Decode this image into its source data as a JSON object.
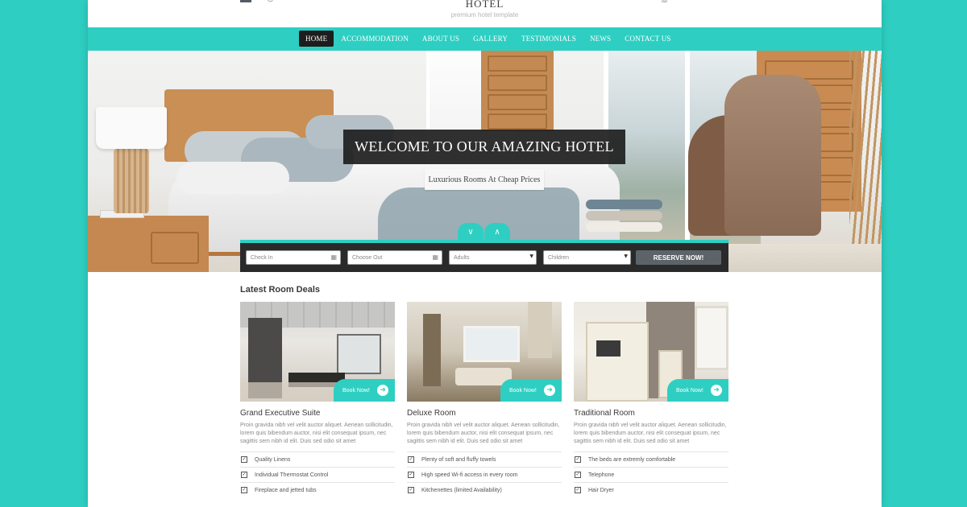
{
  "header": {
    "logo_title": "HOTEL",
    "logo_subtitle": "premium hotel template"
  },
  "nav": {
    "items": [
      "HOME",
      "ACCOMMODATION",
      "ABOUT US",
      "GALLERY",
      "TESTIMONIALS",
      "NEWS",
      "CONTACT US"
    ],
    "active": "HOME"
  },
  "hero": {
    "title": "WELCOME TO OUR AMAZING HOTEL",
    "subtitle": "Luxurious Rooms At Cheap Prices"
  },
  "booking": {
    "check_in_placeholder": "Check In",
    "check_out_placeholder": "Choose Out",
    "adults_value": "Adults",
    "children_value": "Children",
    "reserve_label": "RESERVE NOW!"
  },
  "deals": {
    "title": "Latest Room Deals",
    "book_label": "Book Now!",
    "cards": [
      {
        "name": "Grand Executive Suite",
        "description": "Proin gravida nibh vel velit auctor aliquet. Aenean sollicitudin, lorem quis bibendum auctor, nisi elit consequat ipsum, nec sagittis sem nibh id elit. Duis sed odio sit amet",
        "features": [
          "Quality Linens",
          "Individual Thermostat Control",
          "Fireplace and jetted tubs"
        ]
      },
      {
        "name": "Deluxe Room",
        "description": "Proin gravida nibh vel velit auctor aliquet. Aenean sollicitudin, lorem quis bibendum auctor, nisi elit consequat ipsum, nec sagittis sem nibh id elit. Duis sed odio sit amet",
        "features": [
          "Plenty of soft and fluffy towels",
          "High speed Wi-fi access in every room",
          "Kitchenettes (limited Availability)"
        ]
      },
      {
        "name": "Traditional Room",
        "description": "Proin gravida nibh vel velit auctor aliquet. Aenean sollicitudin, lorem quis bibendum auctor, nisi elit consequat ipsum, nec sagittis sem nibh id elit. Duis sed odio sit amet",
        "features": [
          "The beds are extremly comfortable",
          "Telephone",
          "Hair Dryer"
        ]
      }
    ]
  },
  "colors": {
    "accent": "#2ecfc2",
    "nav_active": "#1d1d1d",
    "booking_bar": "#2a2a2a",
    "reserve_button": "#5d6469"
  }
}
